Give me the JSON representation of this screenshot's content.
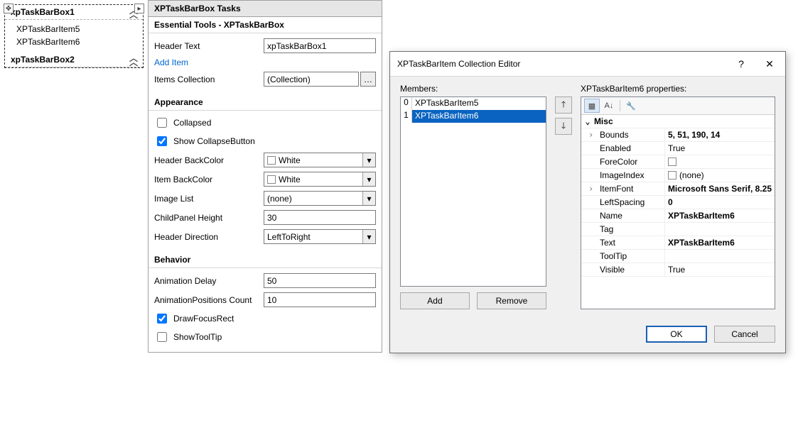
{
  "designer": {
    "group1": {
      "header": "xpTaskBarBox1",
      "items": [
        "XPTaskBarItem5",
        "XPTaskBarItem6"
      ]
    },
    "group2": {
      "header": "xpTaskBarBox2"
    }
  },
  "tasks": {
    "title": "XPTaskBarBox Tasks",
    "section_tools": "Essential Tools - XPTaskBarBox",
    "header_text_label": "Header Text",
    "header_text_value": "xpTaskBarBox1",
    "add_item": "Add Item",
    "items_collection_label": "Items Collection",
    "items_collection_value": "(Collection)",
    "section_appearance": "Appearance",
    "collapsed": "Collapsed",
    "show_collapse_btn": "Show CollapseButton",
    "header_backcolor_label": "Header BackColor",
    "header_backcolor_value": "White",
    "item_backcolor_label": "Item BackColor",
    "item_backcolor_value": "White",
    "image_list_label": "Image List",
    "image_list_value": "(none)",
    "childpanel_height_label": "ChildPanel Height",
    "childpanel_height_value": "30",
    "header_direction_label": "Header Direction",
    "header_direction_value": "LeftToRight",
    "section_behavior": "Behavior",
    "animation_delay_label": "Animation Delay",
    "animation_delay_value": "50",
    "anim_positions_label": "AnimationPositions Count",
    "anim_positions_value": "10",
    "draw_focus_rect": "DrawFocusRect",
    "show_tooltip": "ShowToolTip"
  },
  "editor": {
    "title": "XPTaskBarItem Collection Editor",
    "help": "?",
    "close": "✕",
    "members_label": "Members:",
    "members": [
      {
        "index": "0",
        "name": "XPTaskBarItem5",
        "selected": false
      },
      {
        "index": "1",
        "name": "XPTaskBarItem6",
        "selected": true
      }
    ],
    "props_label": "XPTaskBarItem6 properties:",
    "add": "Add",
    "remove": "Remove",
    "ok": "OK",
    "cancel": "Cancel",
    "cat_misc": "Misc",
    "props": {
      "bounds_k": "Bounds",
      "bounds_v": "5, 51, 190, 14",
      "enabled_k": "Enabled",
      "enabled_v": "True",
      "forecolor_k": "ForeColor",
      "imageindex_k": "ImageIndex",
      "imageindex_v": "(none)",
      "itemfont_k": "ItemFont",
      "itemfont_v": "Microsoft Sans Serif, 8.25",
      "leftspacing_k": "LeftSpacing",
      "leftspacing_v": "0",
      "name_k": "Name",
      "name_v": "XPTaskBarItem6",
      "tag_k": "Tag",
      "text_k": "Text",
      "text_v": "XPTaskBarItem6",
      "tooltip_k": "ToolTip",
      "visible_k": "Visible",
      "visible_v": "True"
    }
  }
}
